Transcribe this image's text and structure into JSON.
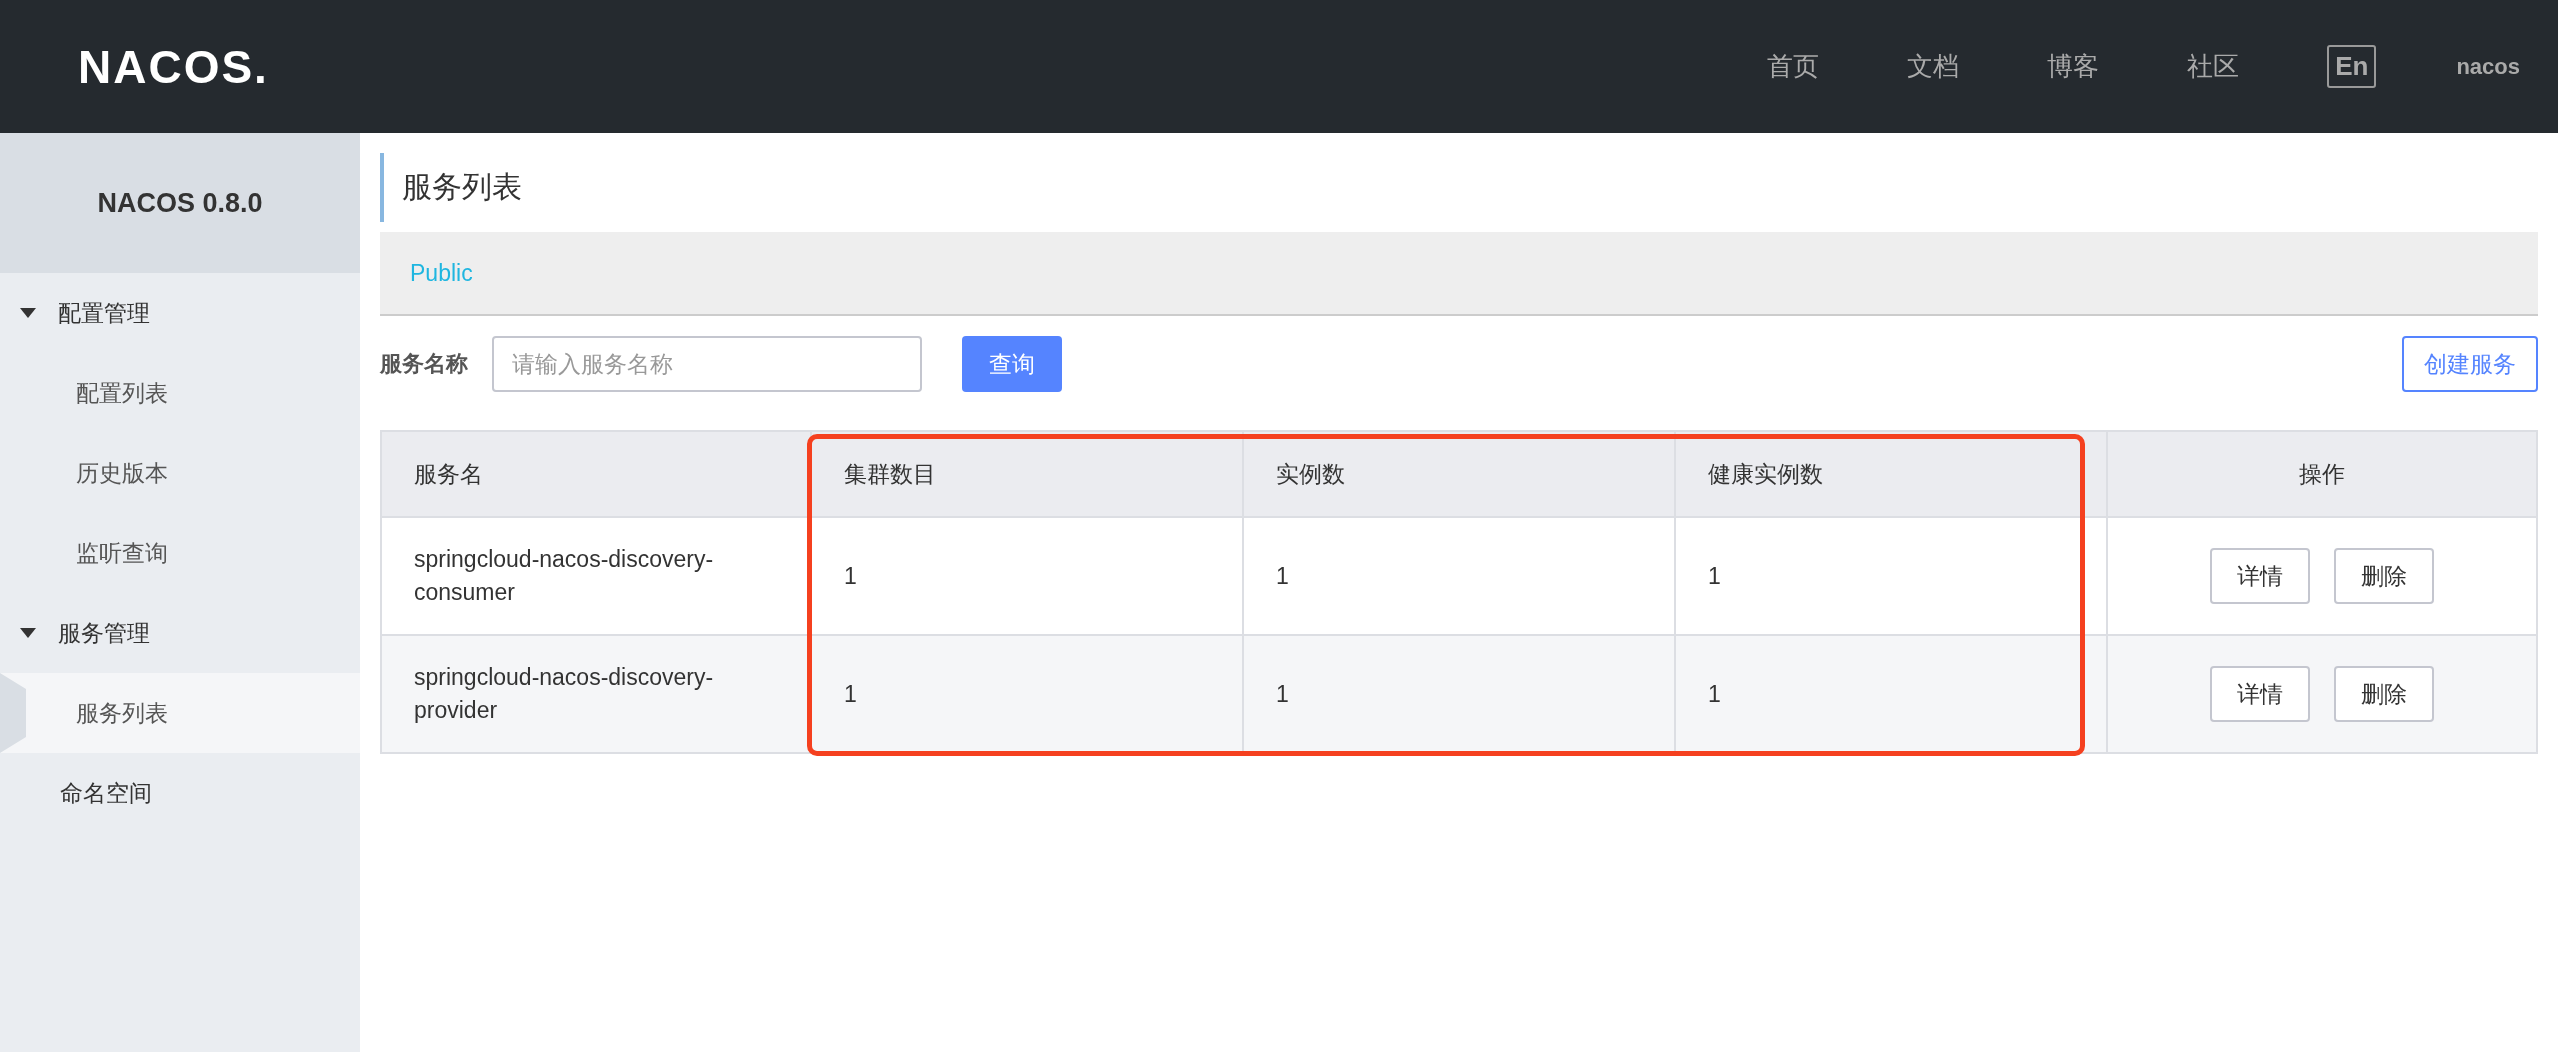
{
  "header": {
    "logo": "NACOS.",
    "nav": [
      "首页",
      "文档",
      "博客",
      "社区"
    ],
    "language": "En",
    "user": "nacos"
  },
  "sidebar": {
    "title": "NACOS 0.8.0",
    "items": [
      {
        "label": "配置管理",
        "expanded": true,
        "children": [
          {
            "label": "配置列表",
            "selected": false
          },
          {
            "label": "历史版本",
            "selected": false
          },
          {
            "label": "监听查询",
            "selected": false
          }
        ]
      },
      {
        "label": "服务管理",
        "expanded": true,
        "children": [
          {
            "label": "服务列表",
            "selected": true
          }
        ]
      },
      {
        "label": "命名空间",
        "selected": false
      }
    ]
  },
  "page": {
    "title": "服务列表",
    "namespace": "Public"
  },
  "search": {
    "label": "服务名称",
    "placeholder": "请输入服务名称",
    "button": "查询",
    "create_button": "创建服务"
  },
  "table": {
    "columns": [
      "服务名",
      "集群数目",
      "实例数",
      "健康实例数",
      "操作"
    ],
    "rows": [
      {
        "name": "springcloud-nacos-discovery-consumer",
        "clusters": "1",
        "instances": "1",
        "healthy": "1",
        "actions": [
          "详情",
          "删除"
        ]
      },
      {
        "name": "springcloud-nacos-discovery-provider",
        "clusters": "1",
        "instances": "1",
        "healthy": "1",
        "actions": [
          "详情",
          "删除"
        ]
      }
    ]
  }
}
